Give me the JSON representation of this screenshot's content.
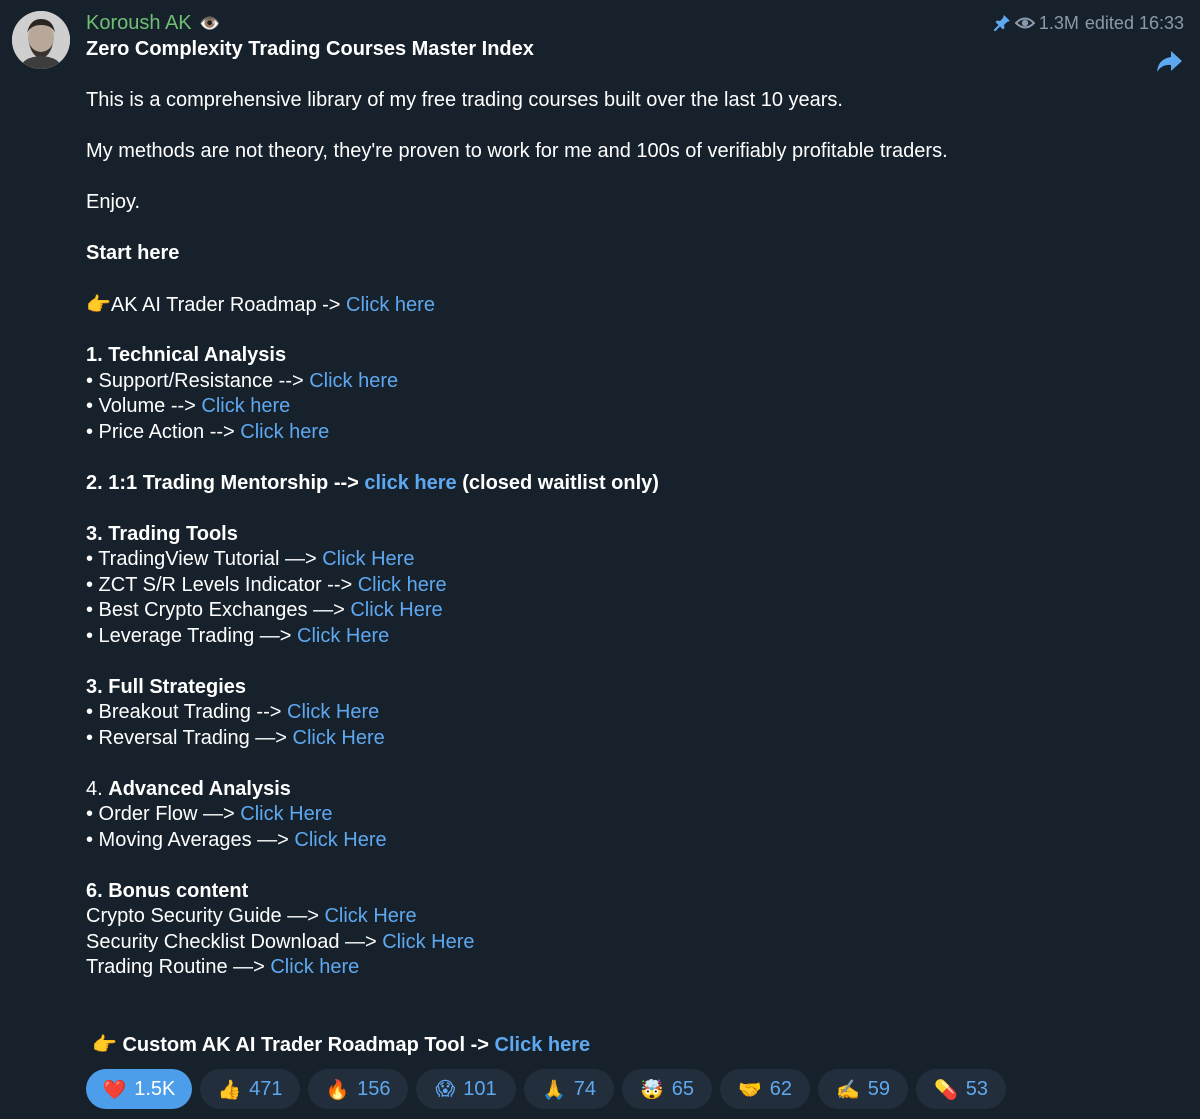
{
  "message": {
    "sender": "Koroush AK",
    "sender_emoji": "👁️",
    "views": "1.3M",
    "edited": "edited 16:33",
    "title": "Zero Complexity Trading Courses Master Index",
    "intro": "This is a comprehensive library of my free trading courses built over the last 10 years.",
    "claim": "My methods are not theory, they're proven to work for me and 100s of verifiably profitable traders.",
    "enjoy": "Enjoy.",
    "start_here": "Start here",
    "roadmap": {
      "emoji": "👉",
      "text": "AK AI Trader Roadmap -> ",
      "link": "Click here"
    },
    "sec1": {
      "heading": "1. Technical Analysis",
      "items": [
        {
          "text": "• Support/Resistance --> ",
          "link": "Click here"
        },
        {
          "text": "• Volume --> ",
          "link": "Click here"
        },
        {
          "text": "• Price Action --> ",
          "link": "Click here"
        }
      ]
    },
    "sec2": {
      "text": "2. 1:1 Trading Mentorship --> ",
      "link": "click here",
      "suffix": " (closed waitlist only)"
    },
    "sec3": {
      "heading": "3. Trading Tools",
      "items": [
        {
          "text": "• TradingView Tutorial —> ",
          "link": "Click Here"
        },
        {
          "text": "• ZCT S/R Levels Indicator --> ",
          "link": "Click here"
        },
        {
          "text": "• Best Crypto Exchanges —> ",
          "link": "Click Here"
        },
        {
          "text": "• Leverage Trading —> ",
          "link": "Click Here"
        }
      ]
    },
    "sec3b": {
      "heading": "3. Full Strategies",
      "items": [
        {
          "text": "• Breakout Trading --> ",
          "link": "Click Here"
        },
        {
          "text": "• Reversal Trading —> ",
          "link": "Click Here"
        }
      ]
    },
    "sec4": {
      "heading_num": "4. ",
      "heading": "Advanced Analysis",
      "items": [
        {
          "text": "• Order Flow —> ",
          "link": "Click Here"
        },
        {
          "text": "• Moving Averages —> ",
          "link": "Click Here"
        }
      ]
    },
    "sec6": {
      "heading": "6. Bonus content",
      "items": [
        {
          "text": "Crypto Security Guide —> ",
          "link": "Click Here"
        },
        {
          "text": "Security Checklist Download —> ",
          "link": "Click Here"
        },
        {
          "text": "Trading Routine —> ",
          "link": "Click here"
        }
      ]
    },
    "footer": {
      "emoji": "👉",
      "text": " Custom AK AI Trader Roadmap Tool -> ",
      "link": "Click here"
    }
  },
  "reactions": [
    {
      "emoji": "❤️",
      "count": "1.5K",
      "active": true
    },
    {
      "emoji": "👍",
      "count": "471"
    },
    {
      "emoji": "🔥",
      "count": "156"
    },
    {
      "emoji": "😱",
      "count": "101"
    },
    {
      "emoji": "🙏",
      "count": "74"
    },
    {
      "emoji": "🤯",
      "count": "65"
    },
    {
      "emoji": "🤝",
      "count": "62"
    },
    {
      "emoji": "✍️",
      "count": "59"
    },
    {
      "emoji": "💊",
      "count": "53"
    }
  ],
  "colors": {
    "background": "#17212b",
    "sender": "#6fbf73",
    "link": "#5ea8f0",
    "meta": "#8a9aab",
    "reaction_bg": "#232e3c",
    "reaction_active": "#4d9eea"
  }
}
